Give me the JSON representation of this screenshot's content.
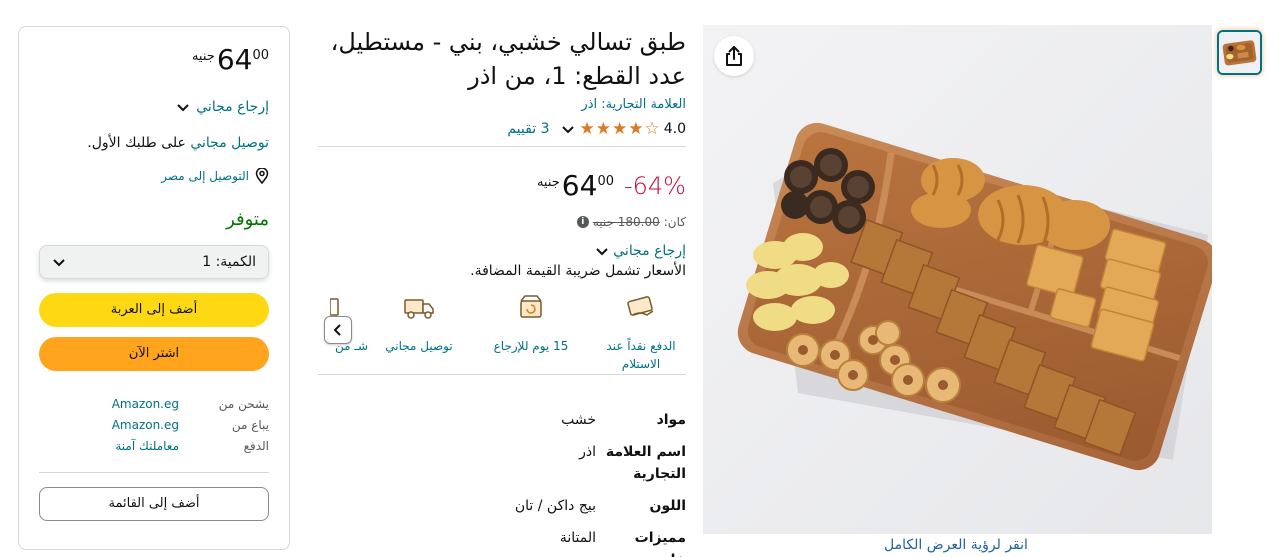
{
  "product": {
    "title": "طبق تسالي خشبي، بني - مستطيل، عدد القطع: 1، من اذر",
    "brand_line": "العلامة التجارية: اذر",
    "rating": "4.0",
    "rating_value": 4.0,
    "rating_count": "3 تقييم",
    "discount": "-64%",
    "price_whole": "64",
    "price_fraction": "00",
    "currency": "جنيه",
    "was_label": "كان:",
    "was_price": "180.00 جنيه",
    "free_returns": "إرجاع مجاني",
    "vat_note": "الأسعار تشمل ضريبة القيمة المضافة."
  },
  "features": [
    {
      "icon": "cash-on-delivery-icon",
      "label": "الدفع نقداً عند الاستلام"
    },
    {
      "icon": "return-box-icon",
      "label": "15 يوم للإرجاع"
    },
    {
      "icon": "free-delivery-truck-icon",
      "label": "توصيل مجاني"
    },
    {
      "icon": "partial-feature-icon",
      "label": "شـ من"
    }
  ],
  "specs": [
    {
      "key": "مواد",
      "value": "خشب"
    },
    {
      "key": "اسم العلامة التجارية",
      "value": "اذر"
    },
    {
      "key": "اللون",
      "value": "بيج داكن / تان"
    },
    {
      "key": "مميزات خاصة",
      "value": "المتانة"
    }
  ],
  "gallery": {
    "zoom_label": "انقر لرؤية العرض الكامل"
  },
  "buybox": {
    "price_whole": "64",
    "price_fraction": "00",
    "currency": "جنيه",
    "free_returns": "إرجاع مجاني",
    "delivery_highlight": "توصيل مجاني",
    "delivery_rest": " على طلبك الأول.",
    "deliver_to": "التوصيل إلى مصر",
    "stock": "متوفر",
    "qty_label": "الكمية:",
    "qty_value": "1",
    "add_to_cart": "أضف إلى العربة",
    "buy_now": "اشتر الآن",
    "ships_from_label": "يشحن من",
    "ships_from_value": "Amazon.eg",
    "sold_by_label": "يباع من",
    "sold_by_value": "Amazon.eg",
    "payment_label": "الدفع",
    "payment_value": "معاملتك آمنة",
    "add_to_list": "أضف إلى القائمة"
  },
  "colors": {
    "link": "#007185",
    "discount": "#cc0c39",
    "stock": "#007600",
    "cart_button": "#ffd814",
    "buy_button": "#ffa41c",
    "star": "#de7921"
  }
}
